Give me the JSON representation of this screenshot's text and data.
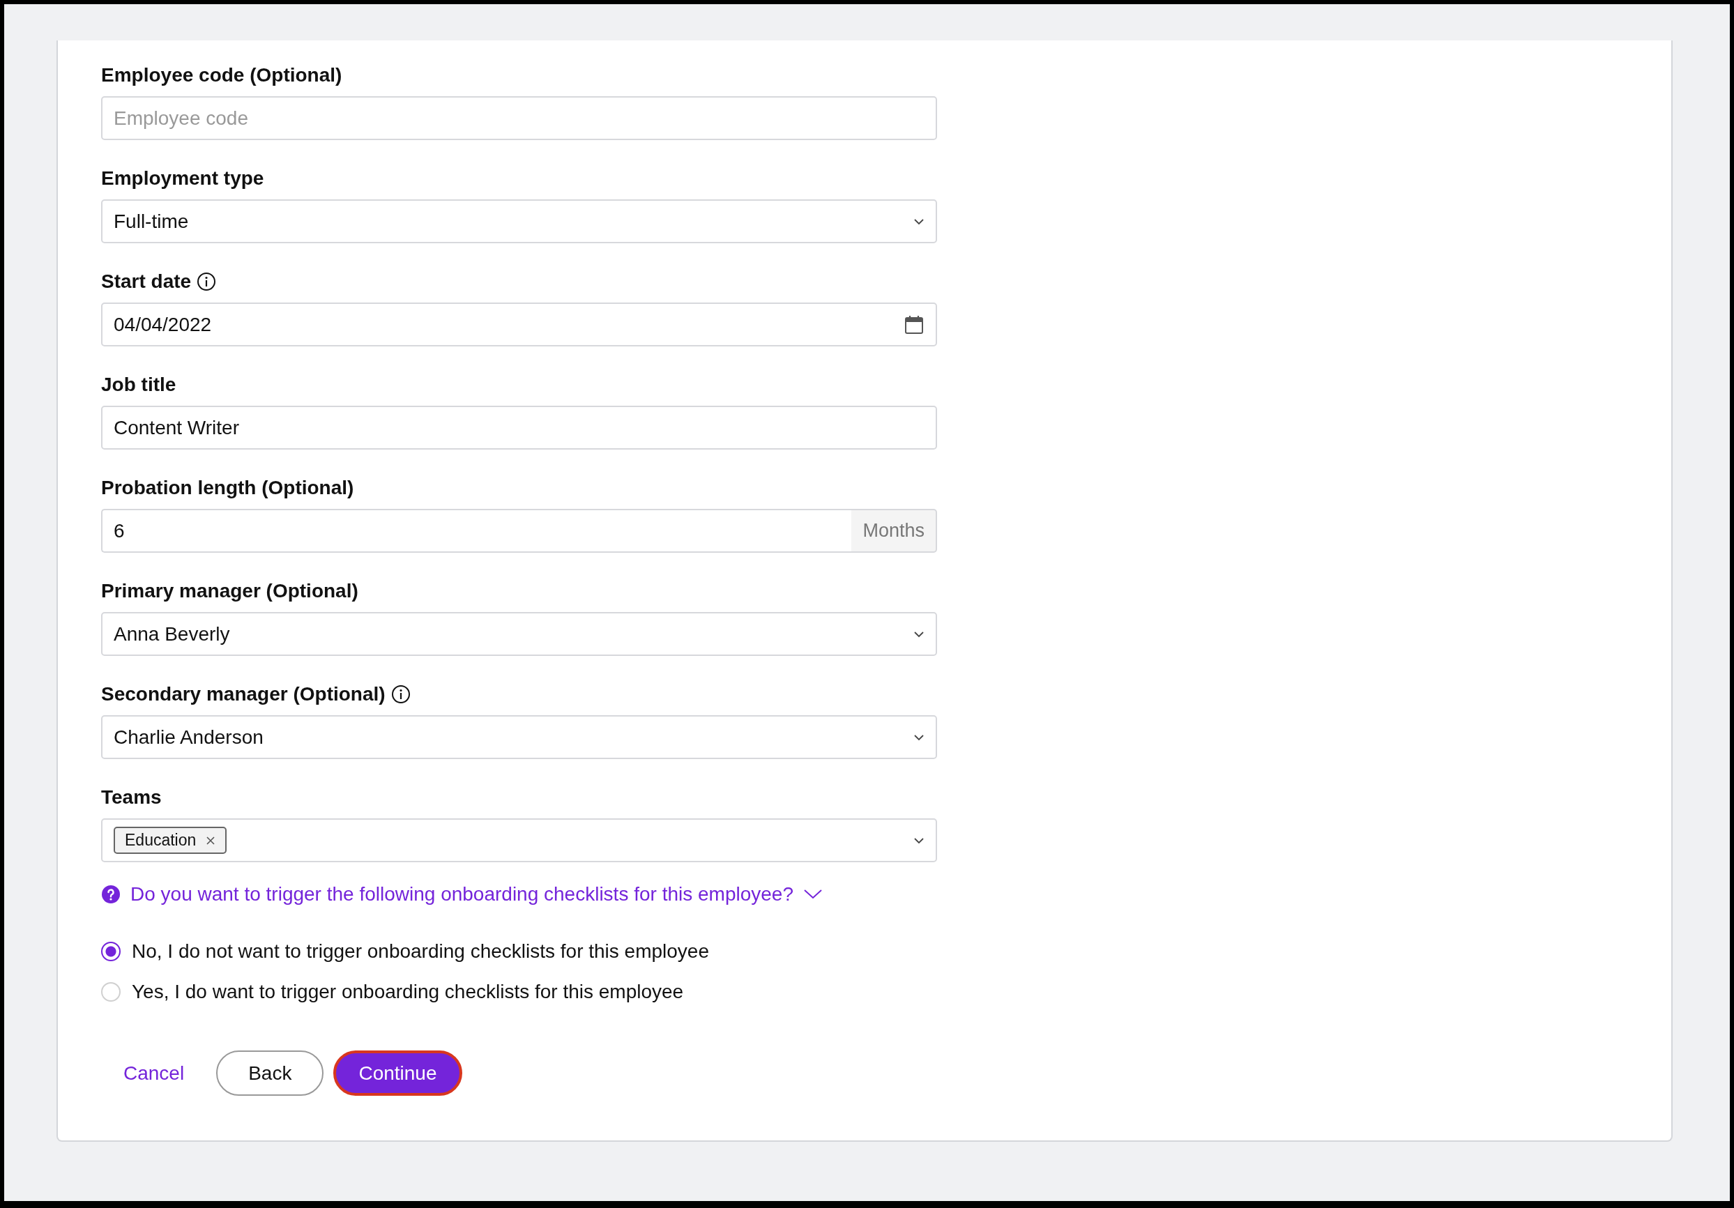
{
  "fields": [
    {
      "kind": "text",
      "label": "Employee code (Optional)",
      "info": false,
      "placeholder": "Employee code"
    },
    {
      "kind": "select",
      "label": "Employment type",
      "info": false,
      "value": "Full-time"
    },
    {
      "kind": "date",
      "label": "Start date",
      "info": true,
      "value": "04/04/2022"
    },
    {
      "kind": "text",
      "label": "Job title",
      "info": false,
      "value": "Content Writer"
    },
    {
      "kind": "suffix",
      "label": "Probation length (Optional)",
      "info": false,
      "value": "6",
      "suffix": "Months"
    },
    {
      "kind": "select",
      "label": "Primary manager (Optional)",
      "info": false,
      "value": "Anna Beverly"
    },
    {
      "kind": "select",
      "label": "Secondary manager (Optional)",
      "info": true,
      "value": "Charlie Anderson"
    },
    {
      "kind": "tags",
      "label": "Teams",
      "info": false,
      "tags": [
        "Education"
      ]
    }
  ],
  "question": {
    "text": "Do you want to trigger the following onboarding checklists for this employee?",
    "expanded": false
  },
  "options": [
    {
      "label": "No, I do not want to trigger onboarding checklists for this employee",
      "selected": true
    },
    {
      "label": "Yes, I do want to trigger onboarding checklists for this employee",
      "selected": false
    }
  ],
  "buttons": [
    {
      "kind": "link",
      "label": "Cancel"
    },
    {
      "kind": "secondary",
      "label": "Back"
    },
    {
      "kind": "primary",
      "label": "Continue"
    }
  ]
}
